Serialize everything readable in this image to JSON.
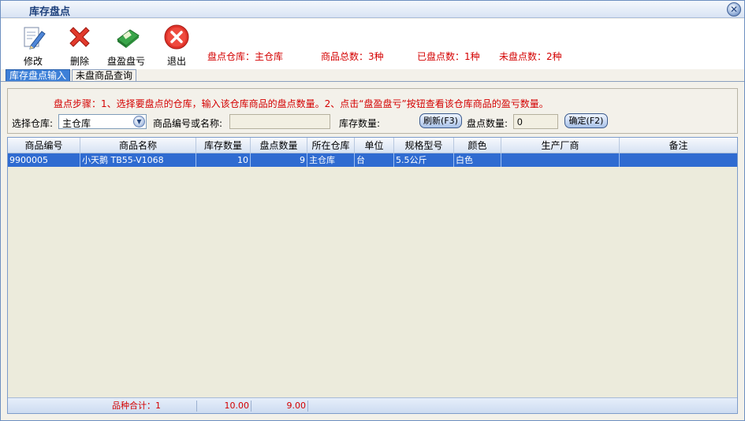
{
  "window": {
    "title": "库存盘点",
    "close_symbol": "✕"
  },
  "toolbar": {
    "edit_label": "修改",
    "delete_label": "删除",
    "profit_loss_label": "盘盈盘亏",
    "exit_label": "退出"
  },
  "status": {
    "warehouse": "盘点仓库：主仓库",
    "total": "商品总数：3种",
    "counted": "已盘点数：1种",
    "uncounted": "未盘点数：2种"
  },
  "tabs": [
    "库存盘点输入",
    "未盘商品查询"
  ],
  "form": {
    "steps": "盘点步骤：1、选择要盘点的仓库，输入该仓库商品的盘点数量。2、点击“盘盈盘亏”按钮查看该仓库商品的盈亏数量。",
    "warehouse_label": "选择仓库:",
    "warehouse_value": "主仓库",
    "product_label": "商品编号或名称:",
    "product_value": "",
    "stock_label": "库存数量:",
    "refresh_label": "刷新(F3)",
    "count_label": "盘点数量:",
    "count_value": "0",
    "confirm_label": "确定(F2)"
  },
  "grid": {
    "headers": [
      "商品编号",
      "商品名称",
      "库存数量",
      "盘点数量",
      "所在仓库",
      "单位",
      "规格型号",
      "颜色",
      "生产厂商",
      "备注"
    ],
    "rows": [
      [
        "9900005",
        "小天鹅 TB55-V1068",
        "10",
        "9",
        "主仓库",
        "台",
        "5.5公斤",
        "白色",
        "",
        ""
      ]
    ],
    "footer": {
      "variety_total": "品种合计：1",
      "stock_total": "10.00",
      "count_total": "9.00"
    }
  },
  "colors": {
    "accent": "#2f6bd1",
    "status_red": "#d40000",
    "title_blue": "#1b3e7a"
  },
  "icons": [
    "close-icon",
    "edit-icon",
    "delete-icon",
    "profit-loss-icon",
    "exit-icon",
    "dropdown-arrow-icon"
  ]
}
